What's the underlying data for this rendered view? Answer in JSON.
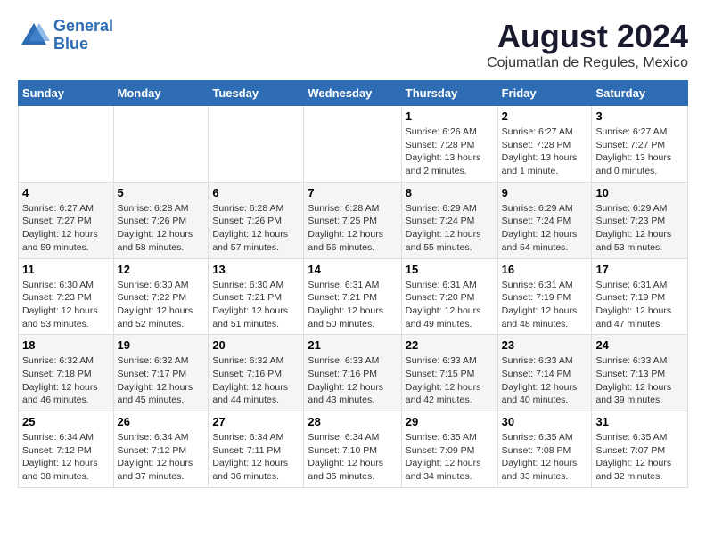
{
  "header": {
    "logo": {
      "line1": "General",
      "line2": "Blue"
    },
    "title": "August 2024",
    "location": "Cojumatlan de Regules, Mexico"
  },
  "weekdays": [
    "Sunday",
    "Monday",
    "Tuesday",
    "Wednesday",
    "Thursday",
    "Friday",
    "Saturday"
  ],
  "weeks": [
    [
      {
        "day": "",
        "info": ""
      },
      {
        "day": "",
        "info": ""
      },
      {
        "day": "",
        "info": ""
      },
      {
        "day": "",
        "info": ""
      },
      {
        "day": "1",
        "info": "Sunrise: 6:26 AM\nSunset: 7:28 PM\nDaylight: 13 hours\nand 2 minutes."
      },
      {
        "day": "2",
        "info": "Sunrise: 6:27 AM\nSunset: 7:28 PM\nDaylight: 13 hours\nand 1 minute."
      },
      {
        "day": "3",
        "info": "Sunrise: 6:27 AM\nSunset: 7:27 PM\nDaylight: 13 hours\nand 0 minutes."
      }
    ],
    [
      {
        "day": "4",
        "info": "Sunrise: 6:27 AM\nSunset: 7:27 PM\nDaylight: 12 hours\nand 59 minutes."
      },
      {
        "day": "5",
        "info": "Sunrise: 6:28 AM\nSunset: 7:26 PM\nDaylight: 12 hours\nand 58 minutes."
      },
      {
        "day": "6",
        "info": "Sunrise: 6:28 AM\nSunset: 7:26 PM\nDaylight: 12 hours\nand 57 minutes."
      },
      {
        "day": "7",
        "info": "Sunrise: 6:28 AM\nSunset: 7:25 PM\nDaylight: 12 hours\nand 56 minutes."
      },
      {
        "day": "8",
        "info": "Sunrise: 6:29 AM\nSunset: 7:24 PM\nDaylight: 12 hours\nand 55 minutes."
      },
      {
        "day": "9",
        "info": "Sunrise: 6:29 AM\nSunset: 7:24 PM\nDaylight: 12 hours\nand 54 minutes."
      },
      {
        "day": "10",
        "info": "Sunrise: 6:29 AM\nSunset: 7:23 PM\nDaylight: 12 hours\nand 53 minutes."
      }
    ],
    [
      {
        "day": "11",
        "info": "Sunrise: 6:30 AM\nSunset: 7:23 PM\nDaylight: 12 hours\nand 53 minutes."
      },
      {
        "day": "12",
        "info": "Sunrise: 6:30 AM\nSunset: 7:22 PM\nDaylight: 12 hours\nand 52 minutes."
      },
      {
        "day": "13",
        "info": "Sunrise: 6:30 AM\nSunset: 7:21 PM\nDaylight: 12 hours\nand 51 minutes."
      },
      {
        "day": "14",
        "info": "Sunrise: 6:31 AM\nSunset: 7:21 PM\nDaylight: 12 hours\nand 50 minutes."
      },
      {
        "day": "15",
        "info": "Sunrise: 6:31 AM\nSunset: 7:20 PM\nDaylight: 12 hours\nand 49 minutes."
      },
      {
        "day": "16",
        "info": "Sunrise: 6:31 AM\nSunset: 7:19 PM\nDaylight: 12 hours\nand 48 minutes."
      },
      {
        "day": "17",
        "info": "Sunrise: 6:31 AM\nSunset: 7:19 PM\nDaylight: 12 hours\nand 47 minutes."
      }
    ],
    [
      {
        "day": "18",
        "info": "Sunrise: 6:32 AM\nSunset: 7:18 PM\nDaylight: 12 hours\nand 46 minutes."
      },
      {
        "day": "19",
        "info": "Sunrise: 6:32 AM\nSunset: 7:17 PM\nDaylight: 12 hours\nand 45 minutes."
      },
      {
        "day": "20",
        "info": "Sunrise: 6:32 AM\nSunset: 7:16 PM\nDaylight: 12 hours\nand 44 minutes."
      },
      {
        "day": "21",
        "info": "Sunrise: 6:33 AM\nSunset: 7:16 PM\nDaylight: 12 hours\nand 43 minutes."
      },
      {
        "day": "22",
        "info": "Sunrise: 6:33 AM\nSunset: 7:15 PM\nDaylight: 12 hours\nand 42 minutes."
      },
      {
        "day": "23",
        "info": "Sunrise: 6:33 AM\nSunset: 7:14 PM\nDaylight: 12 hours\nand 40 minutes."
      },
      {
        "day": "24",
        "info": "Sunrise: 6:33 AM\nSunset: 7:13 PM\nDaylight: 12 hours\nand 39 minutes."
      }
    ],
    [
      {
        "day": "25",
        "info": "Sunrise: 6:34 AM\nSunset: 7:12 PM\nDaylight: 12 hours\nand 38 minutes."
      },
      {
        "day": "26",
        "info": "Sunrise: 6:34 AM\nSunset: 7:12 PM\nDaylight: 12 hours\nand 37 minutes."
      },
      {
        "day": "27",
        "info": "Sunrise: 6:34 AM\nSunset: 7:11 PM\nDaylight: 12 hours\nand 36 minutes."
      },
      {
        "day": "28",
        "info": "Sunrise: 6:34 AM\nSunset: 7:10 PM\nDaylight: 12 hours\nand 35 minutes."
      },
      {
        "day": "29",
        "info": "Sunrise: 6:35 AM\nSunset: 7:09 PM\nDaylight: 12 hours\nand 34 minutes."
      },
      {
        "day": "30",
        "info": "Sunrise: 6:35 AM\nSunset: 7:08 PM\nDaylight: 12 hours\nand 33 minutes."
      },
      {
        "day": "31",
        "info": "Sunrise: 6:35 AM\nSunset: 7:07 PM\nDaylight: 12 hours\nand 32 minutes."
      }
    ]
  ]
}
